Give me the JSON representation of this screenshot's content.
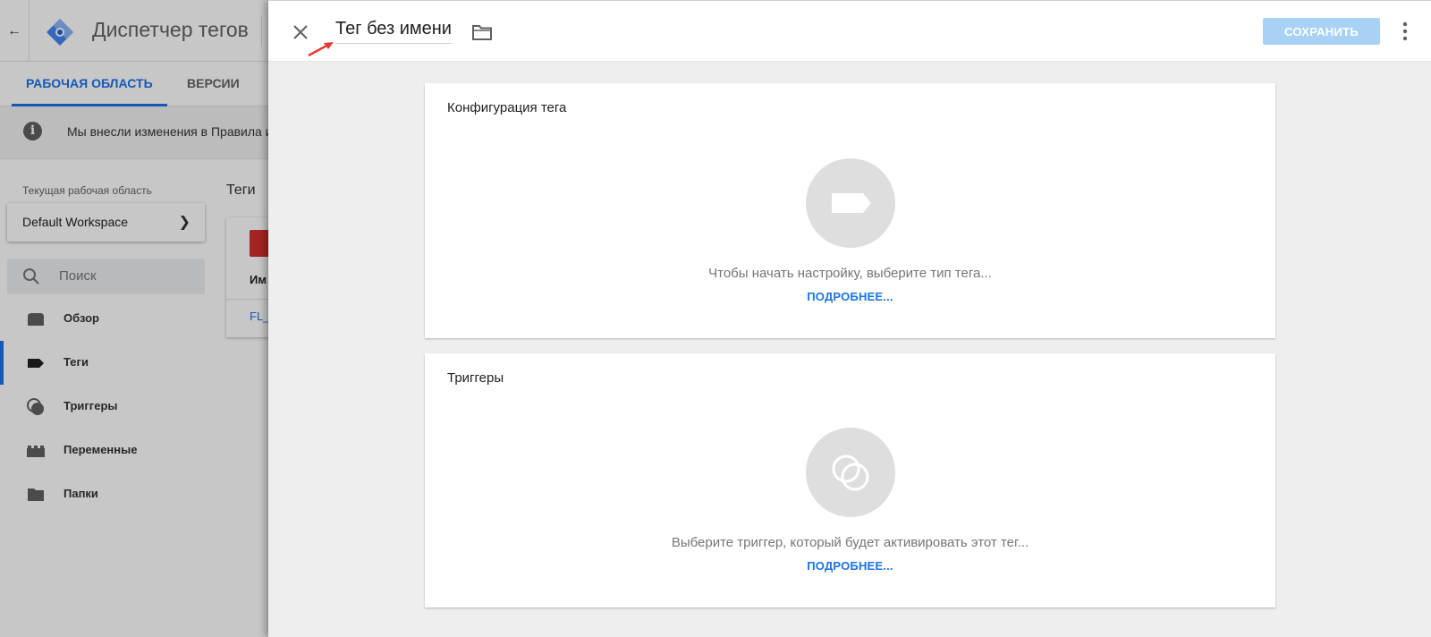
{
  "app": {
    "title": "Диспетчер тегов"
  },
  "tabs": [
    {
      "label": "РАБОЧАЯ ОБЛАСТЬ",
      "active": true
    },
    {
      "label": "ВЕРСИИ",
      "active": false
    }
  ],
  "notice": {
    "text": "Мы внесли изменения в Правила и"
  },
  "sidebar": {
    "workspace_label": "Текущая рабочая область",
    "workspace_name": "Default Workspace",
    "search_placeholder": "Поиск",
    "items": [
      {
        "label": "Обзор",
        "icon": "overview-icon",
        "active": false
      },
      {
        "label": "Теги",
        "icon": "tag-icon",
        "active": true
      },
      {
        "label": "Триггеры",
        "icon": "trigger-icon",
        "active": false
      },
      {
        "label": "Переменные",
        "icon": "variables-icon",
        "active": false
      },
      {
        "label": "Папки",
        "icon": "folder-icon",
        "active": false
      }
    ]
  },
  "background_main": {
    "title": "Теги",
    "table_header": "Им",
    "row_link": "FL_"
  },
  "panel": {
    "title": "Тег без имени",
    "save_label": "СОХРАНИТЬ",
    "tag_config": {
      "title": "Конфигурация тега",
      "hint": "Чтобы начать настройку, выберите тип тега...",
      "more": "ПОДРОБНЕЕ..."
    },
    "triggers": {
      "title": "Триггеры",
      "hint": "Выберите триггер, который будет активировать этот тег...",
      "more": "ПОДРОБНЕЕ..."
    }
  },
  "colors": {
    "accent": "#1a73e8",
    "save_button_disabled": "#a8d2f5",
    "annotation_arrow": "#e53935",
    "tag_red": "#d32f2f"
  }
}
